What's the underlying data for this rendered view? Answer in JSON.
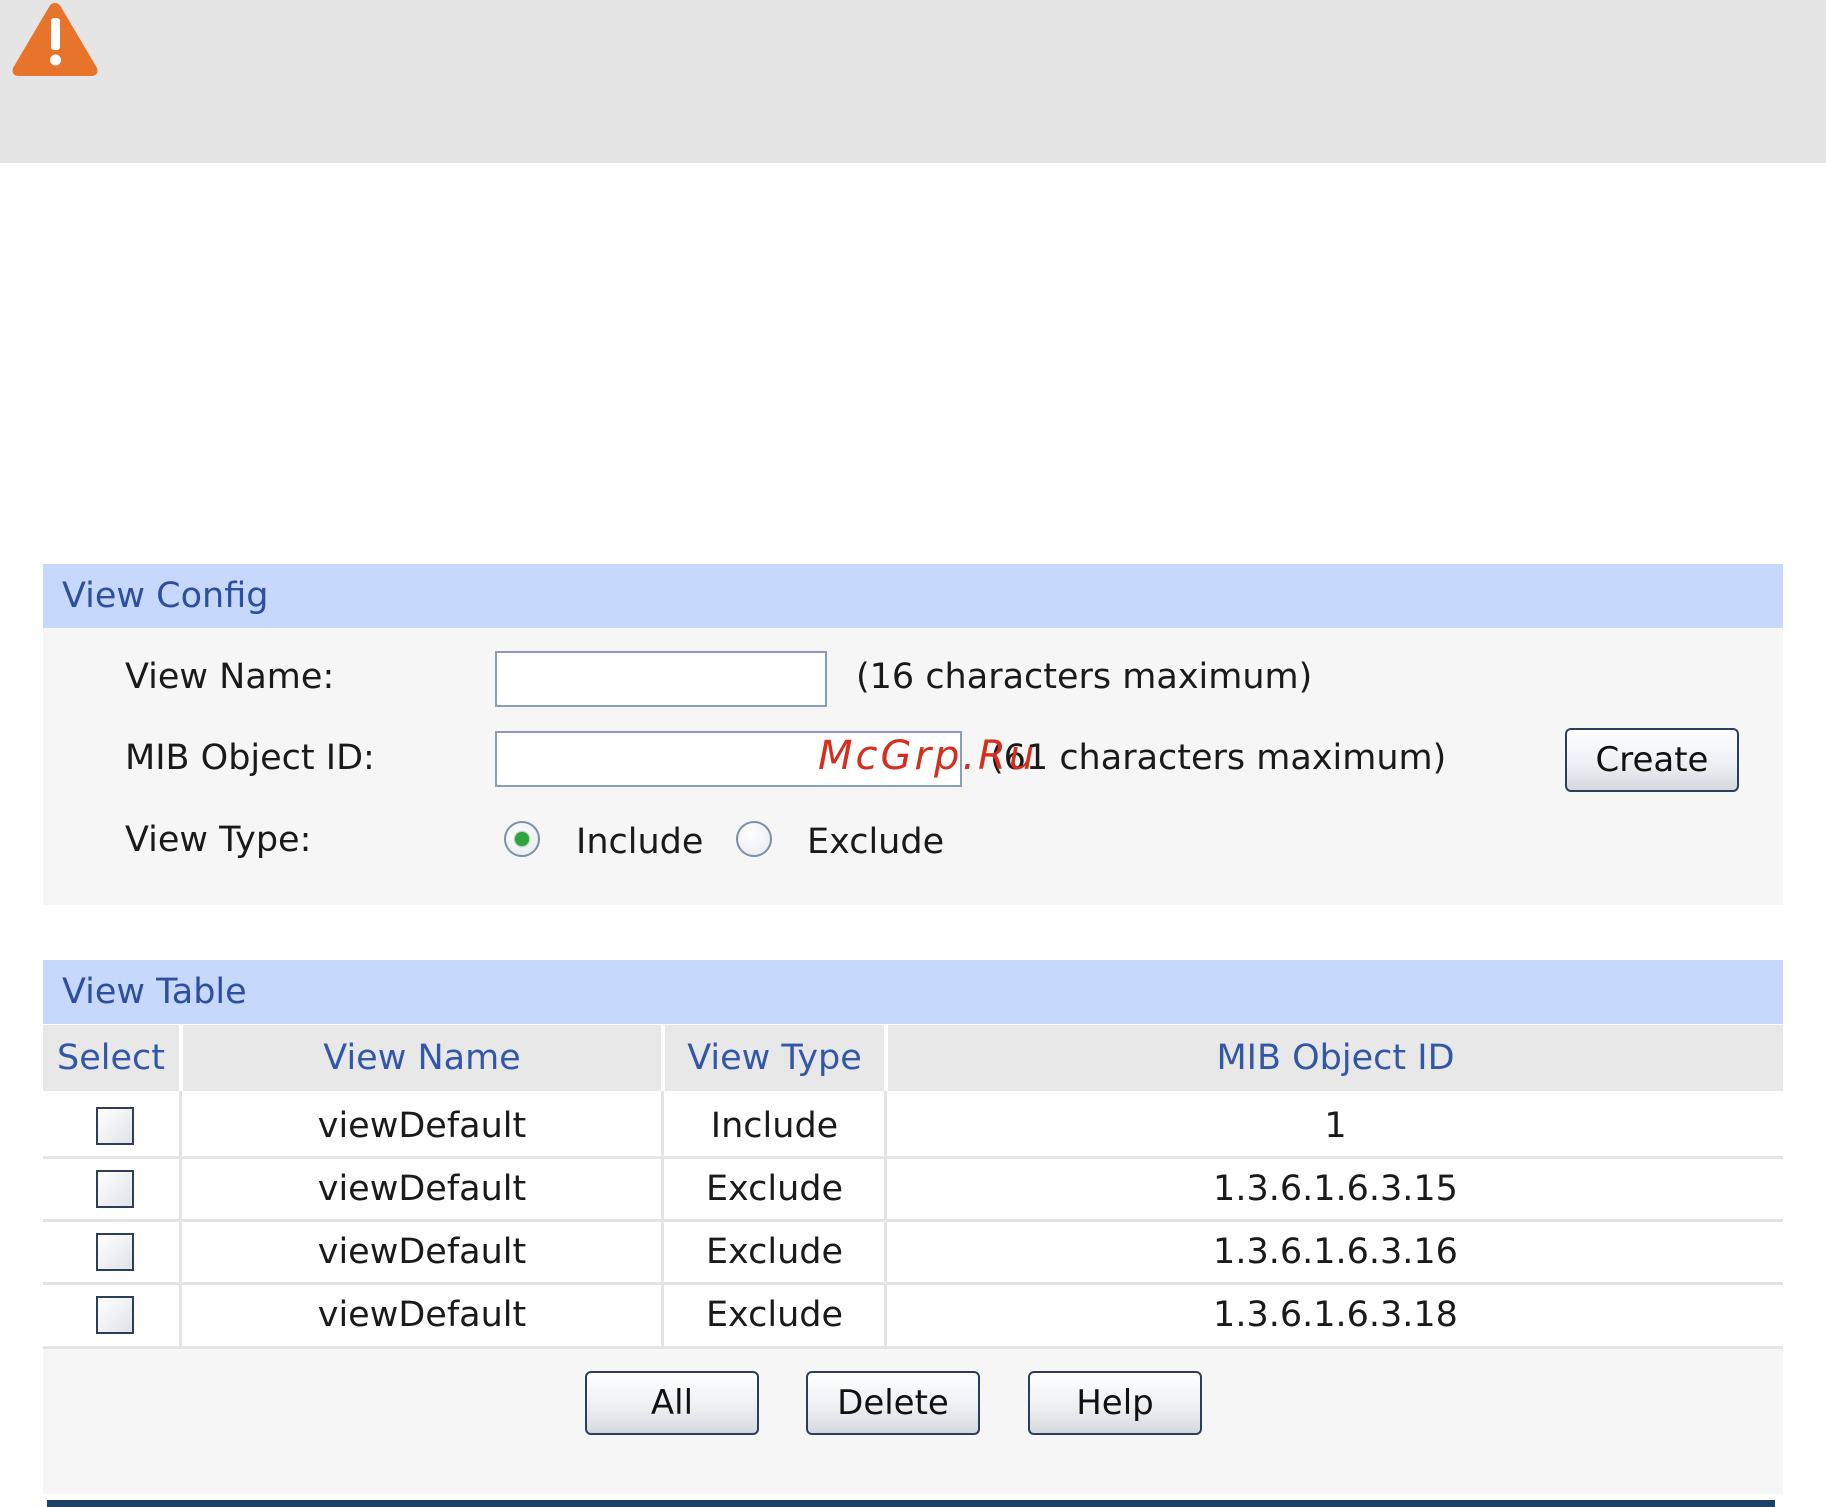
{
  "view_config": {
    "title": "View Config",
    "view_name_label": "View Name:",
    "view_name_value": "",
    "view_name_hint": "(16 characters maximum)",
    "mib_object_id_label": "MIB Object ID:",
    "mib_object_id_value": "",
    "mib_object_id_hint": "(61 characters maximum)",
    "view_type_label": "View Type:",
    "view_type_options": [
      "Include",
      "Exclude"
    ],
    "view_type_selected": "Include",
    "create_label": "Create"
  },
  "view_table": {
    "title": "View Table",
    "columns": [
      "Select",
      "View Name",
      "View Type",
      "MIB Object ID"
    ],
    "rows": [
      {
        "view_name": "viewDefault",
        "view_type": "Include",
        "mib_object_id": "1"
      },
      {
        "view_name": "viewDefault",
        "view_type": "Exclude",
        "mib_object_id": "1.3.6.1.6.3.15"
      },
      {
        "view_name": "viewDefault",
        "view_type": "Exclude",
        "mib_object_id": "1.3.6.1.6.3.16"
      },
      {
        "view_name": "viewDefault",
        "view_type": "Exclude",
        "mib_object_id": "1.3.6.1.6.3.18"
      }
    ],
    "buttons": {
      "all": "All",
      "delete": "Delete",
      "help": "Help"
    }
  },
  "watermark": "McGrp.Ru",
  "colors": {
    "warning": "#e8732a",
    "section_header_bg": "#c6d8fb",
    "section_header_text": "#2f4f9e",
    "column_header_text": "#3357a8",
    "bottom_bar": "#1e3f66"
  },
  "icons": {
    "warning": "warning-triangle-icon"
  }
}
